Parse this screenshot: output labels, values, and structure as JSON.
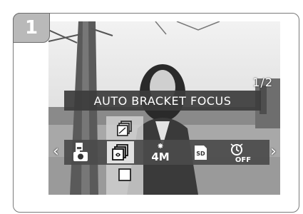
{
  "step": {
    "number": "1"
  },
  "screen": {
    "page_indicator": "1/2",
    "title": "AUTO BRACKET FOCUS",
    "menu": {
      "left_arrow": "‹",
      "right_arrow": "›",
      "items": [
        {
          "icon": "camera-mode-icon",
          "selected": false
        },
        {
          "icon": "bracket-focus-icon",
          "selected": true
        },
        {
          "icon": "image-size-icon",
          "label": "4M",
          "selected": false
        },
        {
          "icon": "sd-card-icon",
          "label": "SD",
          "selected": false
        },
        {
          "icon": "self-timer-off-icon",
          "label": "OFF",
          "selected": false
        }
      ]
    },
    "submenu": {
      "options": [
        {
          "icon": "bracket-exposure-icon"
        },
        {
          "icon": "bracket-focus-icon"
        },
        {
          "icon": "single-frame-icon"
        }
      ]
    }
  },
  "colors": {
    "menu_bar": "#4b4b4b",
    "selected": "#e0e0e0",
    "badge": "#b9b9b9"
  }
}
